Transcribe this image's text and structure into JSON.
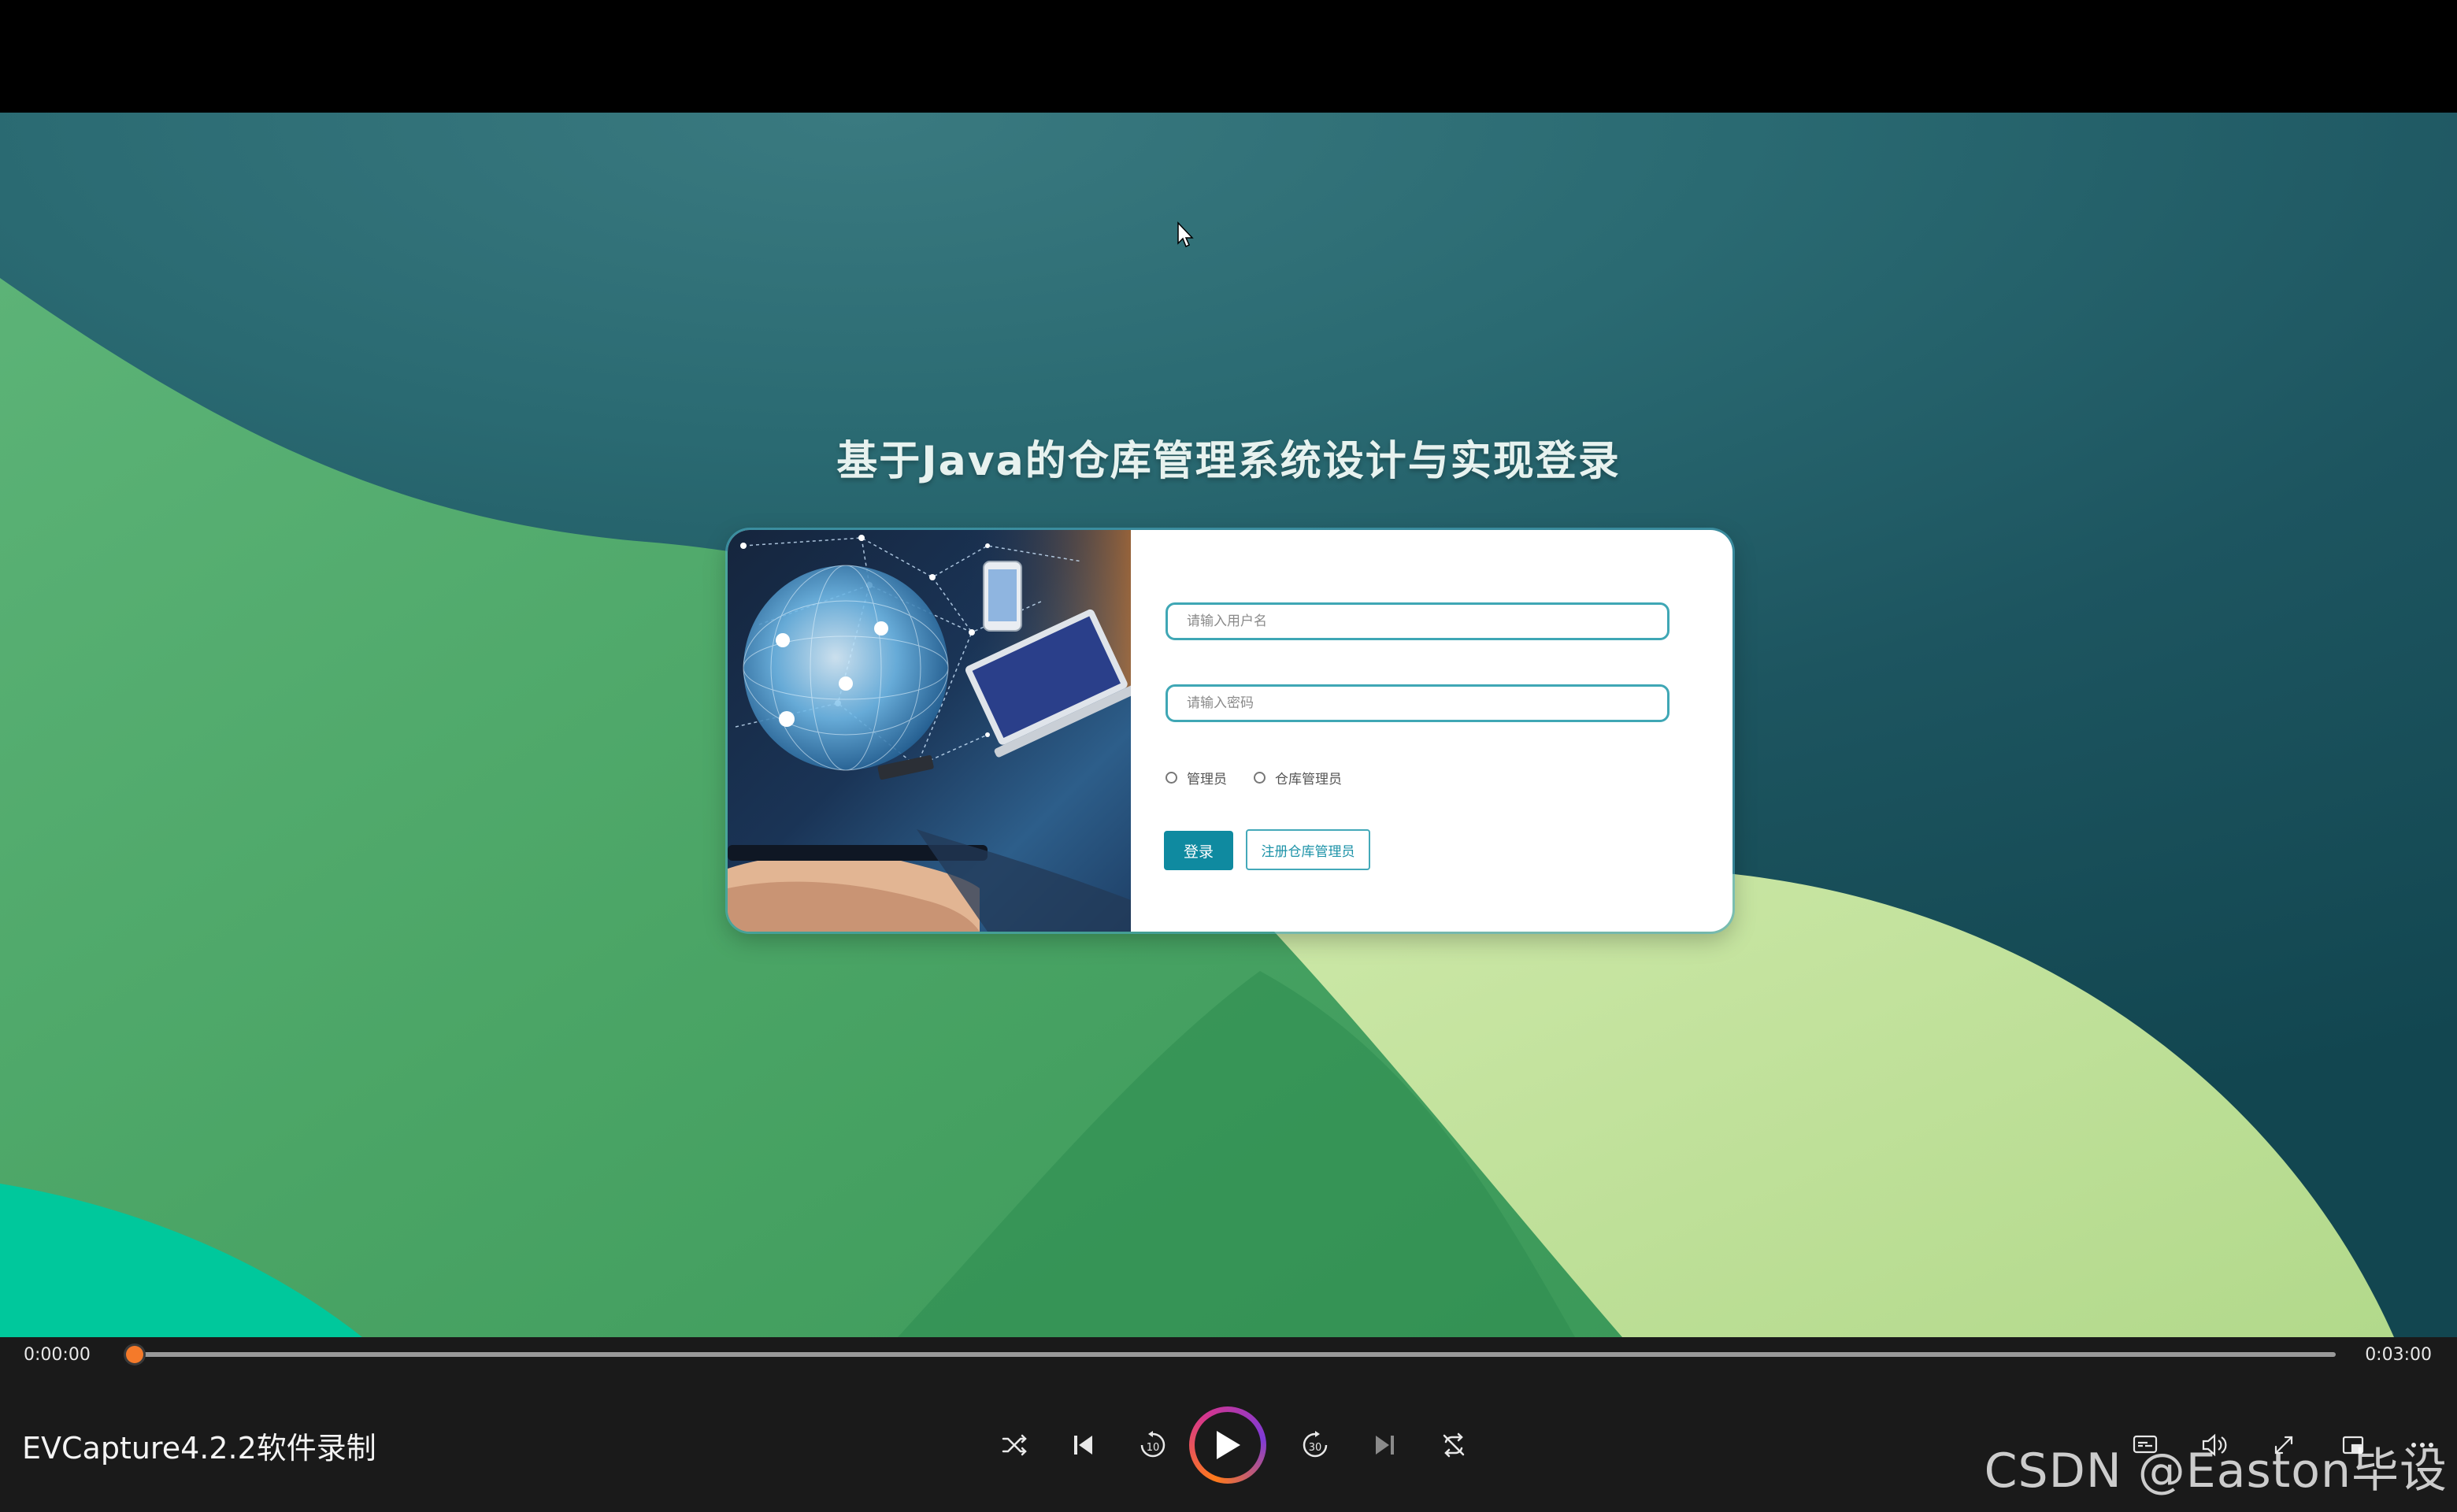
{
  "page": {
    "title": "基于Java的仓库管理系统设计与实现登录"
  },
  "login": {
    "username_placeholder": "请输入用户名",
    "password_placeholder": "请输入密码",
    "roles": [
      "管理员",
      "仓库管理员"
    ],
    "login_label": "登录",
    "register_label": "注册仓库管理员"
  },
  "player": {
    "current_time": "0:00:00",
    "total_time": "0:03:00",
    "progress": 0,
    "media_title": "EVCapture4.2.2软件录制",
    "controls": [
      "shuffle-icon",
      "previous-icon",
      "rewind-10-icon",
      "play-icon",
      "forward-30-icon",
      "next-icon",
      "repeat-off-icon",
      "subtitles-icon",
      "volume-icon",
      "fullscreen-icon",
      "mini-player-icon",
      "more-icon"
    ],
    "skip_back_seconds": "10",
    "skip_forward_seconds": "30"
  },
  "watermark": "CSDN @Easton毕设",
  "colors": {
    "accent": "#0f8aa0",
    "progress": "#f47a2a",
    "background_teal": "#1d5560",
    "green_dark": "#4da869",
    "green_light": "#c0e09a"
  }
}
